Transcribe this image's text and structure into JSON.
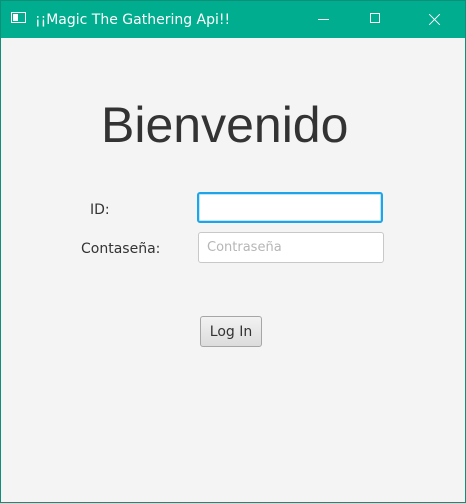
{
  "window": {
    "title": "¡¡Magic The Gathering Api!!",
    "titlebar_color": "#00ae8f",
    "controls": {
      "minimize_icon": "minimize-icon",
      "maximize_icon": "maximize-icon",
      "close_icon": "close-icon"
    }
  },
  "login": {
    "heading": "Bienvenido",
    "id_label": "ID:",
    "id_value": "",
    "password_label": "Contaseña:",
    "password_placeholder": "Contraseña",
    "button_label": "Log In"
  }
}
